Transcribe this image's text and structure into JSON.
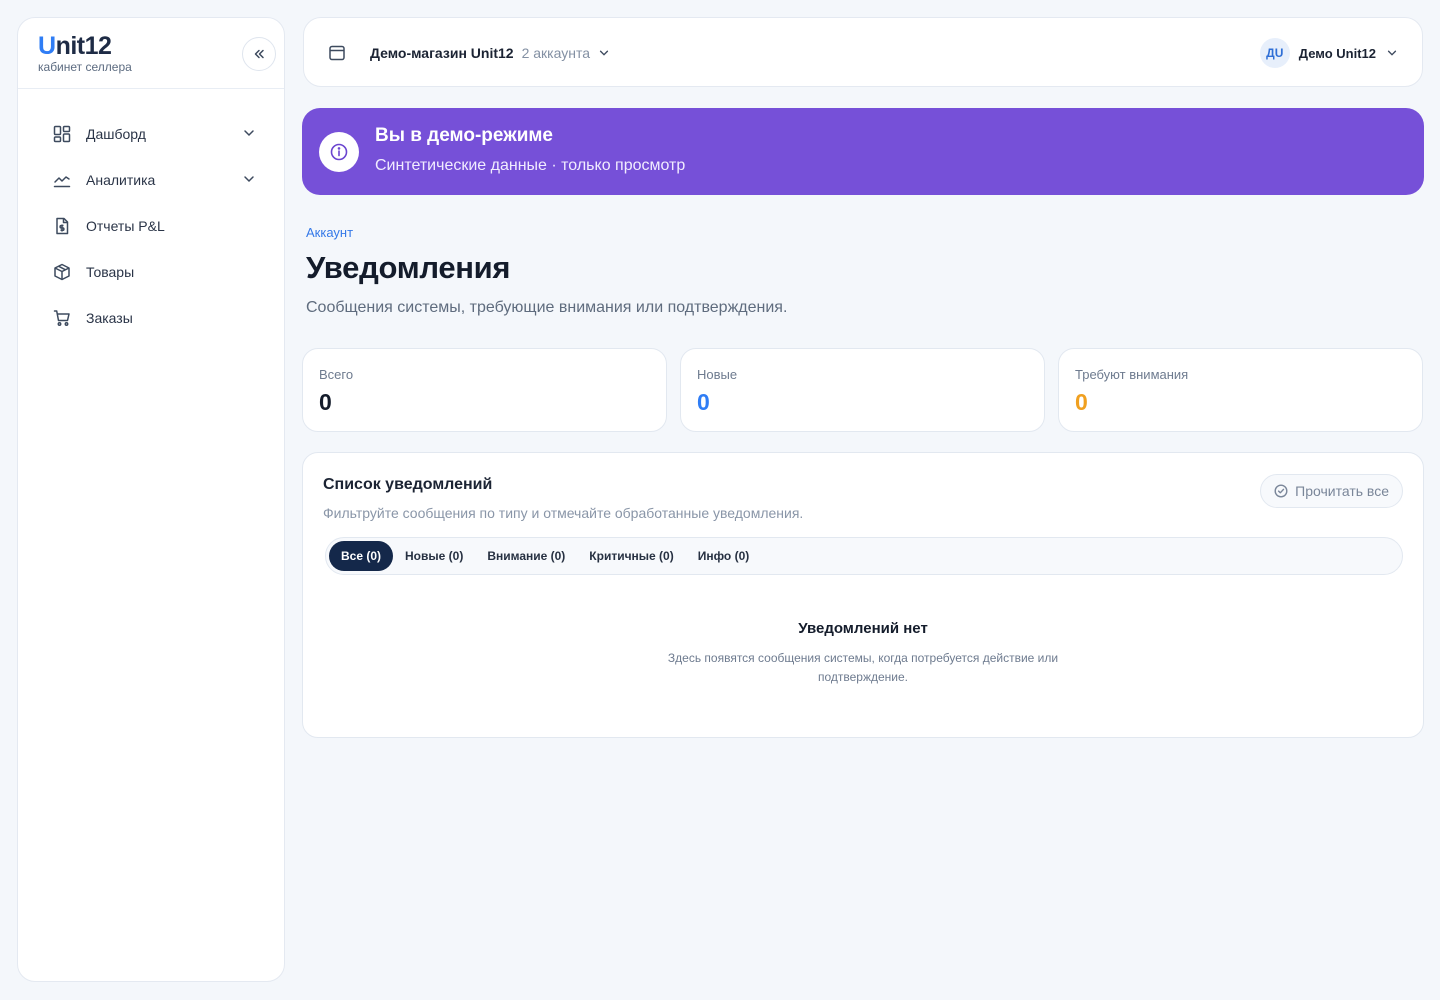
{
  "brand": {
    "logo_u": "U",
    "logo_rest": "nit12",
    "subtitle": "кабинет селлера"
  },
  "sidebar": {
    "items": [
      {
        "label": "Дашборд",
        "icon": "dashboard-icon",
        "has_chevron": true
      },
      {
        "label": "Аналитика",
        "icon": "chart-line-icon",
        "has_chevron": true
      },
      {
        "label": "Отчеты P&L",
        "icon": "file-dollar-icon",
        "has_chevron": false
      },
      {
        "label": "Товары",
        "icon": "box-icon",
        "has_chevron": false
      },
      {
        "label": "Заказы",
        "icon": "cart-icon",
        "has_chevron": false
      }
    ]
  },
  "topbar": {
    "store_name": "Демо-магазин Unit12",
    "accounts_count": "2 аккаунта",
    "avatar_initials": "ДU",
    "user_name": "Демо Unit12"
  },
  "demo_banner": {
    "title": "Вы в демо-режиме",
    "subtitle": "Синтетические данные · только просмотр"
  },
  "page": {
    "breadcrumb": "Аккаунт",
    "title": "Уведомления",
    "subtitle": "Сообщения системы, требующие внимания или подтверждения."
  },
  "stats": [
    {
      "label": "Всего",
      "value": "0",
      "color": "#141c2b"
    },
    {
      "label": "Новые",
      "value": "0",
      "color": "#2f7df5"
    },
    {
      "label": "Требуют внимания",
      "value": "0",
      "color": "#f0a020"
    }
  ],
  "notifications": {
    "title": "Список уведомлений",
    "subtitle": "Фильтруйте сообщения по типу и отмечайте обработанные уведомления.",
    "read_all_label": "Прочитать все",
    "tabs": [
      {
        "label": "Все (0)",
        "active": true
      },
      {
        "label": "Новые (0)",
        "active": false
      },
      {
        "label": "Внимание (0)",
        "active": false
      },
      {
        "label": "Критичные (0)",
        "active": false
      },
      {
        "label": "Инфо (0)",
        "active": false
      }
    ],
    "empty_title": "Уведомлений нет",
    "empty_subtitle": "Здесь появятся сообщения системы, когда потребуется действие или подтверждение."
  }
}
